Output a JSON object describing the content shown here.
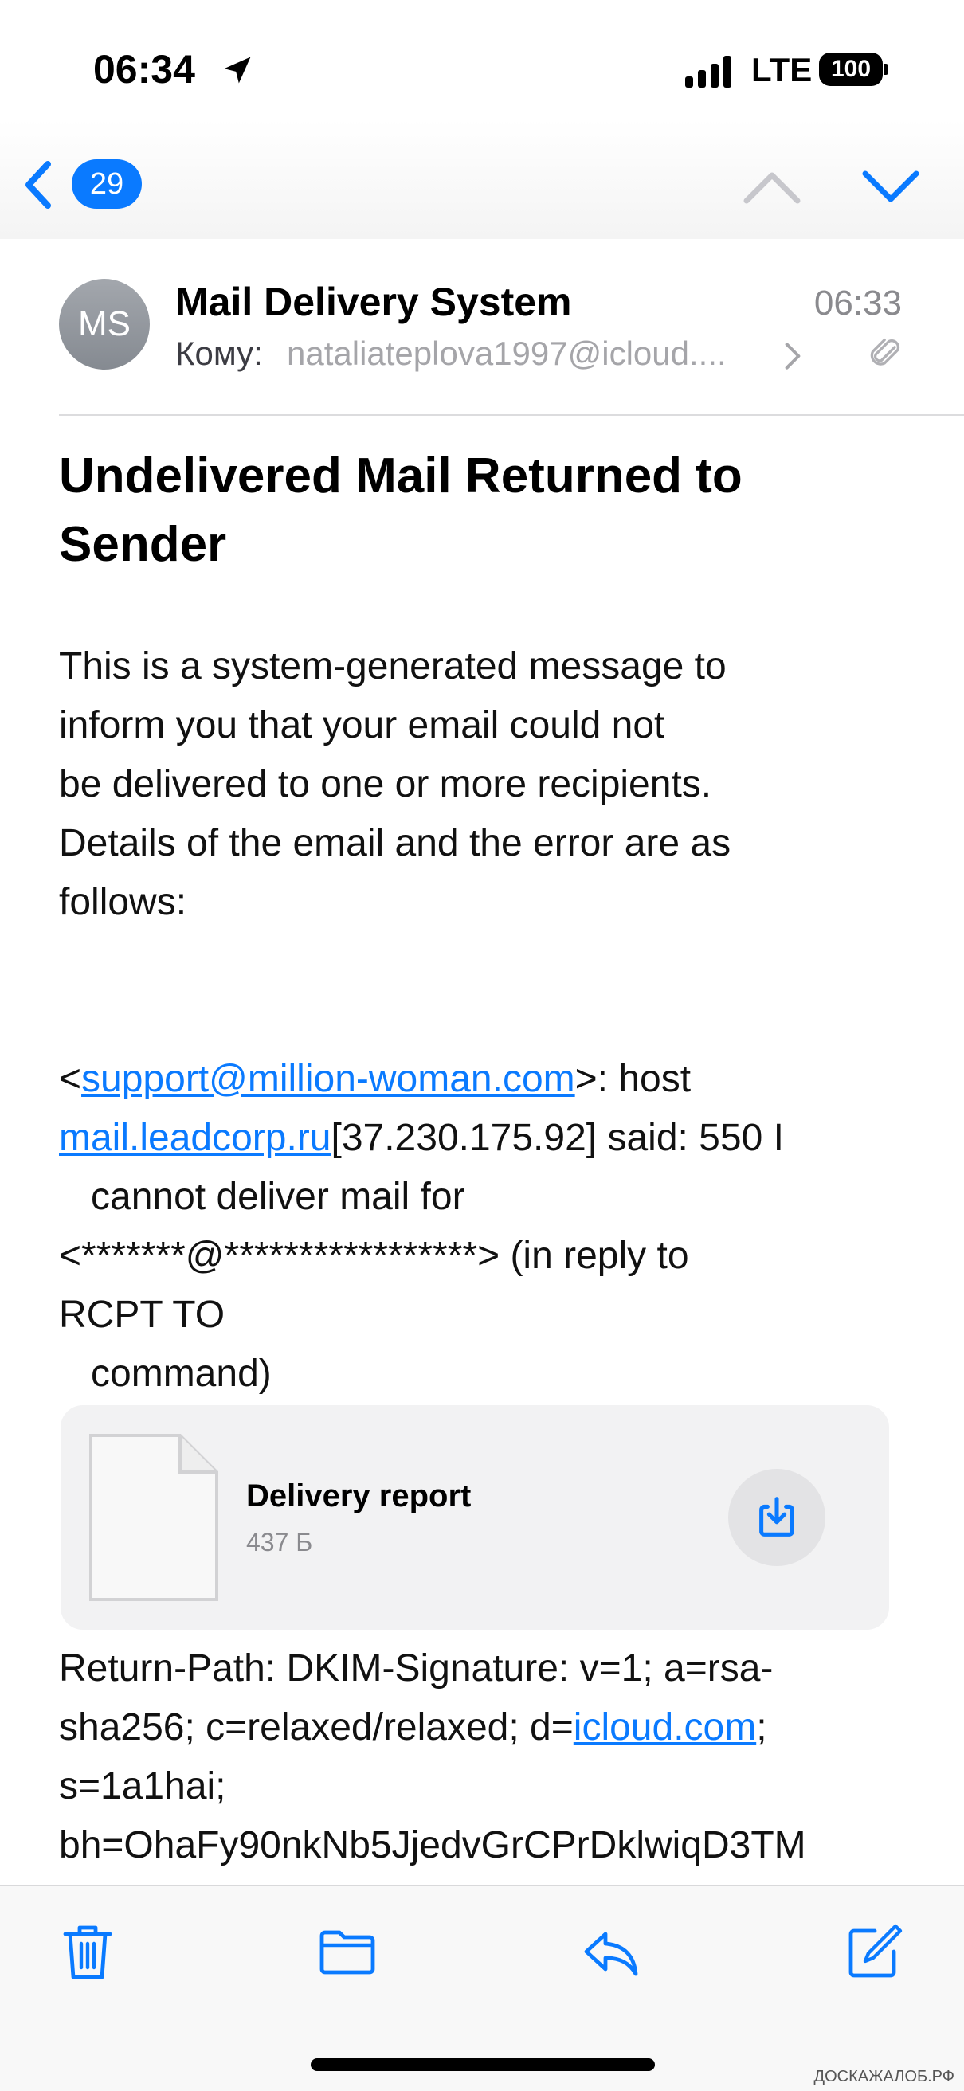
{
  "status_bar": {
    "time": "06:34",
    "carrier": "LTE",
    "battery": "100"
  },
  "nav": {
    "unread_count": "29"
  },
  "message": {
    "avatar_initials": "MS",
    "sender": "Mail Delivery System",
    "time": "06:33",
    "to_label": "Кому:",
    "to_value": "nataliateplova1997@icloud....",
    "subject": "Undelivered Mail Returned to Sender",
    "intro_lines": [
      "This is a system-generated message to",
      "inform you that your email could not",
      "be delivered to one or more recipients.",
      "Details of the email and the error are as",
      "follows:"
    ],
    "bounce": {
      "lt": "<",
      "recipient_link": "support@million-woman.com",
      "after_recipient": ">: host",
      "host_link": "mail.leadcorp.ru",
      "after_host": "[37.230.175.92] said: 550 I",
      "line3": "   cannot deliver mail for",
      "line4": "<*******@*****************> (in reply to",
      "line5": "RCPT TO",
      "line6": "   command)"
    },
    "attachment": {
      "name": "Delivery report",
      "size": "437 Б"
    },
    "headers": {
      "line1": "Return-Path: DKIM-Signature: v=1; a=rsa-",
      "line2_pre": "sha256; c=relaxed/relaxed; d=",
      "line2_link": "icloud.com",
      "line2_post": ";",
      "line3": "s=1a1hai;",
      "line4": "bh=OhaFy90nkNb5JjedvGrCPrDklwiqD3TM"
    }
  },
  "watermark": "ДОСКАЖАЛОБ.РФ",
  "colors": {
    "accent": "#0a7aff",
    "secondary_text": "#8a8a8e",
    "attachment_bg": "#f2f2f3"
  },
  "icons": {
    "back": "chevron-left-icon",
    "previous": "chevron-up-icon",
    "next": "chevron-down-icon",
    "attachment": "paperclip-icon",
    "download": "download-icon",
    "trash": "trash-icon",
    "folder": "folder-icon",
    "reply": "reply-icon",
    "compose": "compose-icon"
  }
}
